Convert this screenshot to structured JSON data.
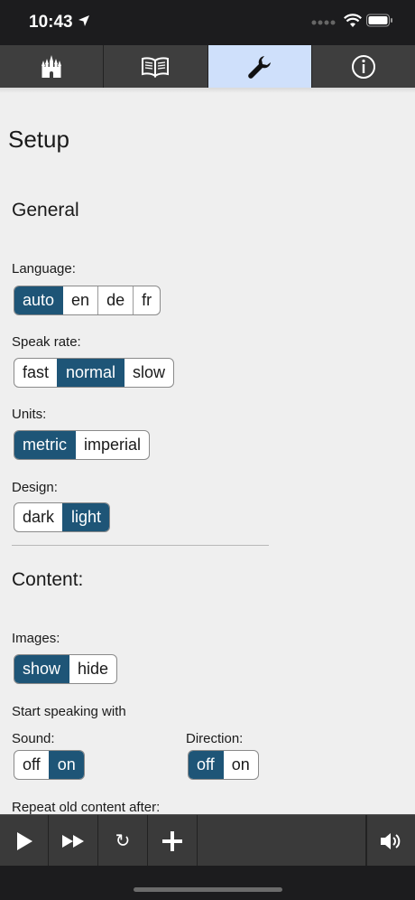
{
  "status_bar": {
    "time": "10:43"
  },
  "tabs": [
    {
      "name": "castle",
      "icon": "castle-icon"
    },
    {
      "name": "book",
      "icon": "book-icon"
    },
    {
      "name": "setup",
      "icon": "wrench-icon",
      "active": true
    },
    {
      "name": "info",
      "icon": "info-icon"
    }
  ],
  "page": {
    "title": "Setup"
  },
  "general": {
    "heading": "General",
    "language": {
      "label": "Language:",
      "options": [
        "auto",
        "en",
        "de",
        "fr"
      ],
      "selected": "auto"
    },
    "speak_rate": {
      "label": "Speak rate:",
      "options": [
        "fast",
        "normal",
        "slow"
      ],
      "selected": "normal"
    },
    "units": {
      "label": "Units:",
      "options": [
        "metric",
        "imperial"
      ],
      "selected": "metric"
    },
    "design": {
      "label": "Design:",
      "options": [
        "dark",
        "light"
      ],
      "selected": "light"
    }
  },
  "content": {
    "heading": "Content:",
    "images": {
      "label": "Images:",
      "options": [
        "show",
        "hide"
      ],
      "selected": "show"
    },
    "start_speaking": "Start speaking with",
    "sound": {
      "label": "Sound:",
      "options": [
        "off",
        "on"
      ],
      "selected": "on"
    },
    "direction": {
      "label": "Direction:",
      "options": [
        "off",
        "on"
      ],
      "selected": "off"
    },
    "repeat_label": "Repeat old content after:"
  },
  "toolbar": {
    "play_icon": "play-icon",
    "fast_forward_icon": "fast-forward-icon",
    "refresh_symbol": "↻",
    "add_icon": "plus-icon",
    "volume_icon": "speaker-icon"
  },
  "colors": {
    "selected": "#1e5577",
    "active_tab": "#cfe0fb",
    "bar": "#3a3a3a"
  }
}
